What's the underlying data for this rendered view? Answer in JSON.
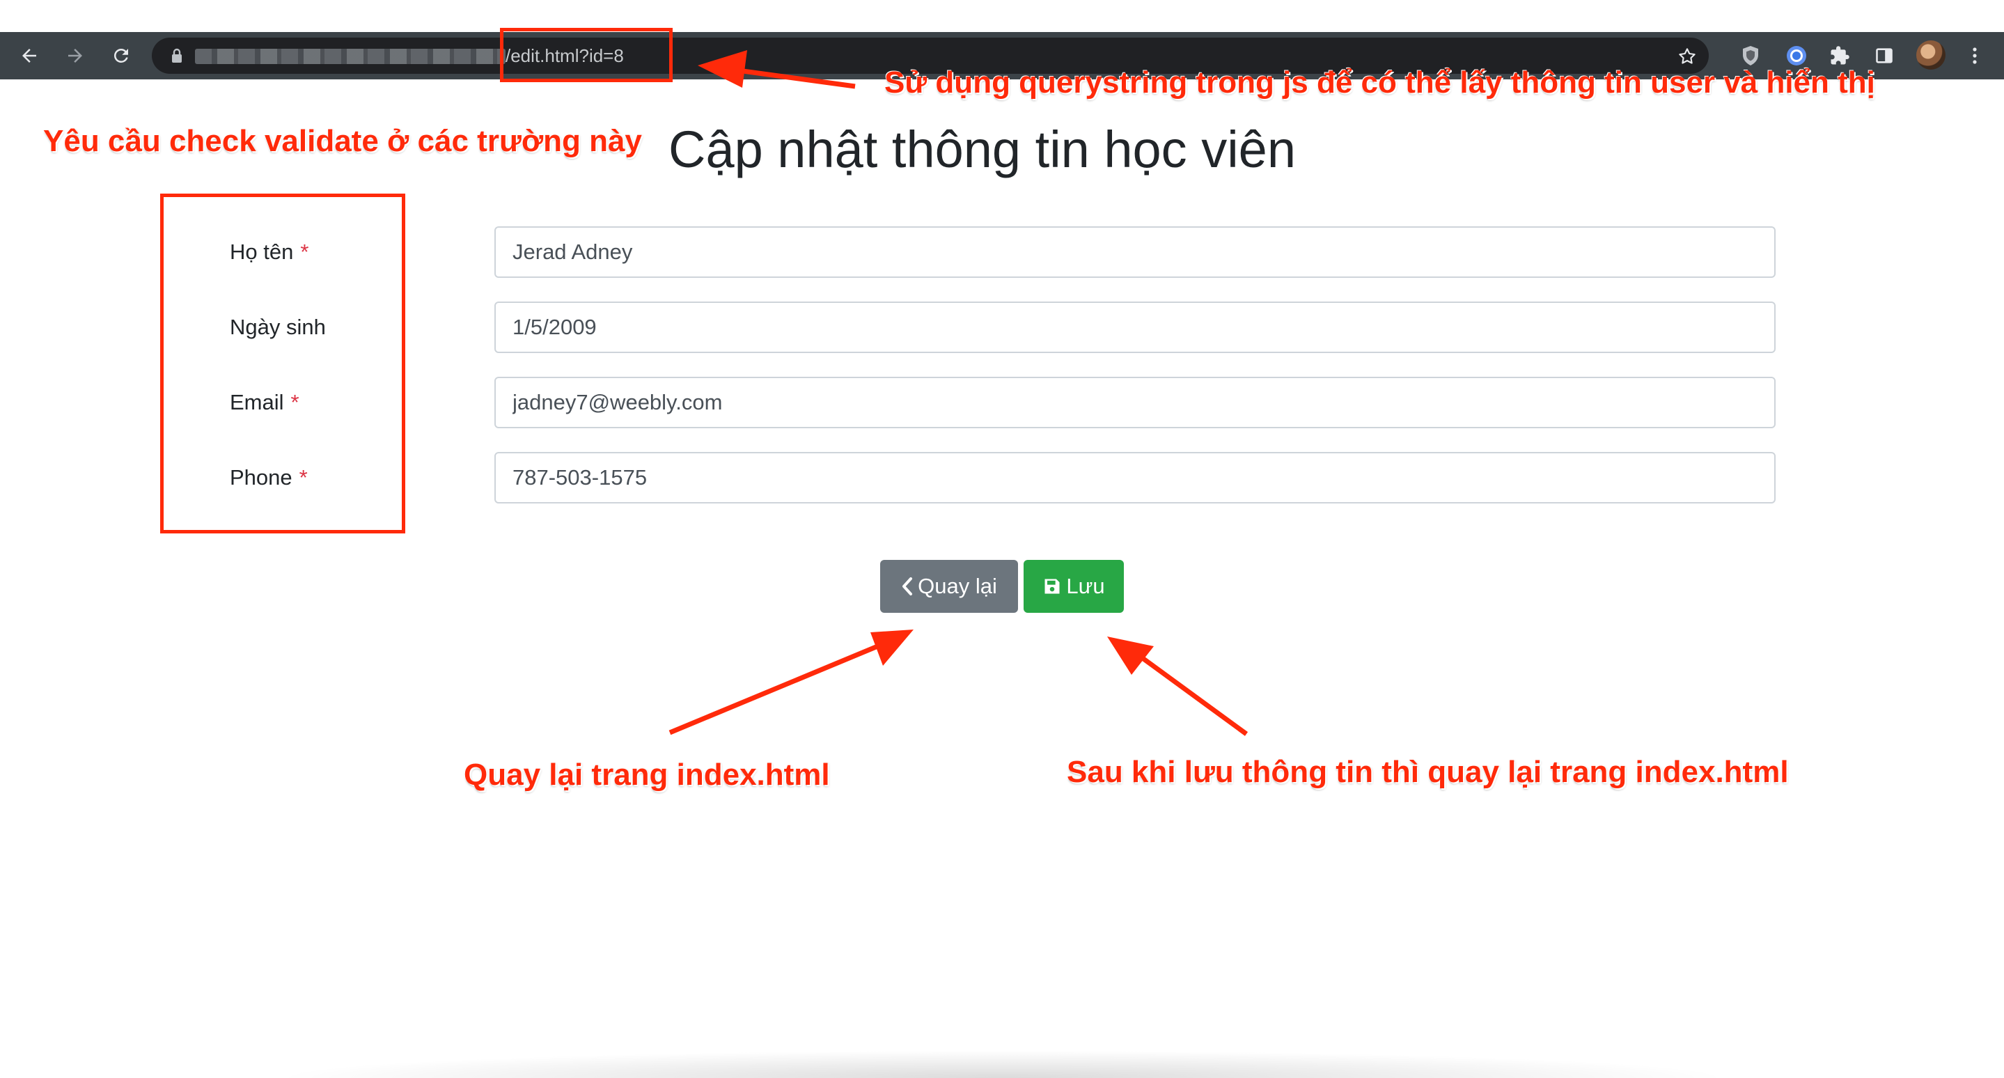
{
  "browser": {
    "url_path": "/edit.html?id=8",
    "icons": {
      "back": "arrow-left-icon",
      "forward": "arrow-right-icon",
      "reload": "reload-icon",
      "lock": "lock-icon",
      "bookmark": "star-icon",
      "extensions": "puzzle-icon",
      "menu": "more-vertical-icon"
    }
  },
  "page": {
    "title": "Cập nhật thông tin học viên",
    "fields": [
      {
        "label": "Họ tên",
        "required_mark": "*",
        "value": "Jerad Adney"
      },
      {
        "label": "Ngày sinh",
        "required_mark": "",
        "value": "1/5/2009"
      },
      {
        "label": "Email",
        "required_mark": "*",
        "value": "jadney7@weebly.com"
      },
      {
        "label": "Phone",
        "required_mark": "*",
        "value": "787-503-1575"
      }
    ],
    "buttons": {
      "back_label": "Quay lại",
      "save_label": "Lưu"
    }
  },
  "annotations": {
    "querystring_note": "Sử dụng querystring trong js để có thể lấy thông tin user và hiển thị",
    "validate_note": "Yêu cầu check validate ở các trường này",
    "back_note": "Quay lại trang index.html",
    "save_note": "Sau khi lưu thông tin thì quay lại trang index.html"
  },
  "colors": {
    "annotation_red": "#ff2a0a",
    "toolbar": "#3c4348",
    "btn_secondary": "#6c757d",
    "btn_success": "#28a745",
    "required_red": "#dc3545"
  }
}
